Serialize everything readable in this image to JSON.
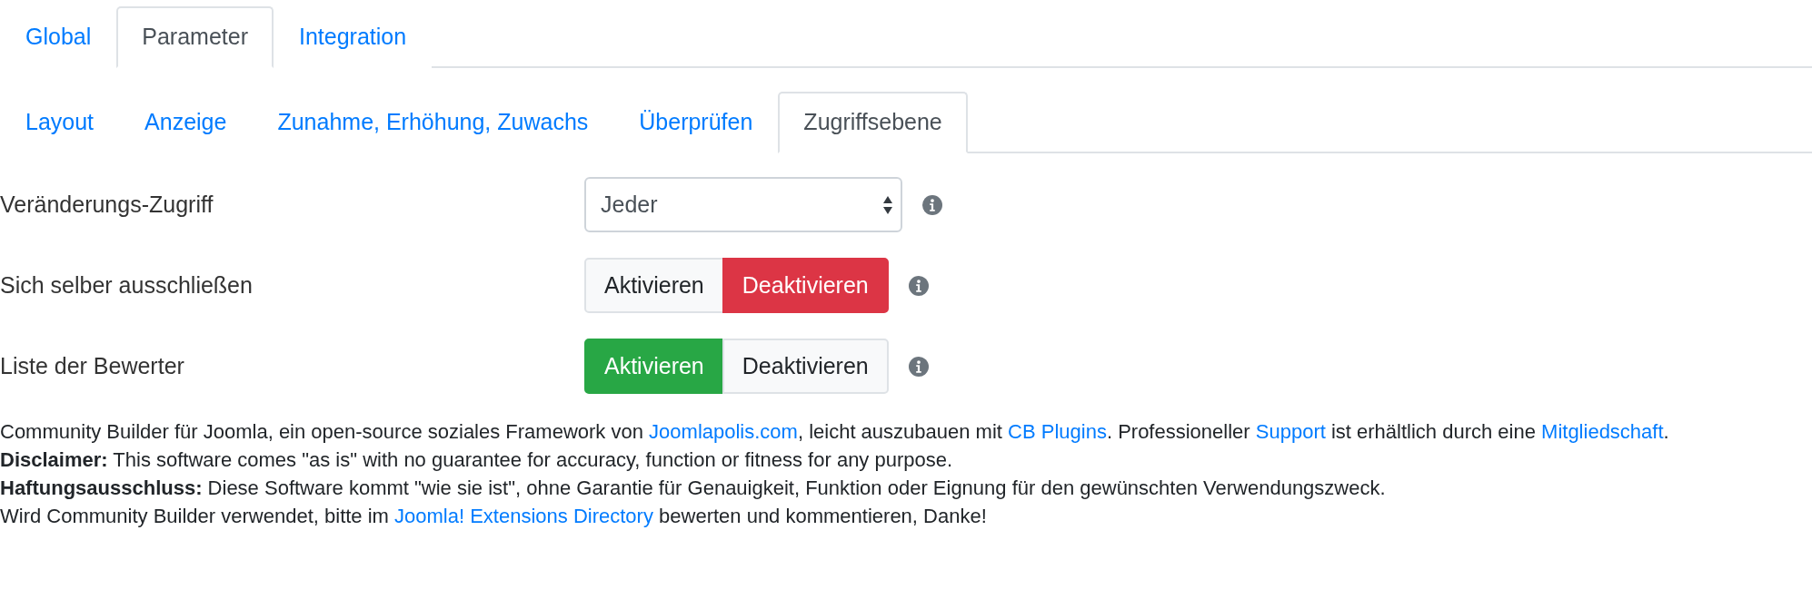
{
  "tabs": [
    {
      "label": "Global",
      "selected": false
    },
    {
      "label": "Parameter",
      "selected": true
    },
    {
      "label": "Integration",
      "selected": false
    }
  ],
  "subtabs": [
    {
      "label": "Layout",
      "selected": false
    },
    {
      "label": "Anzeige",
      "selected": false
    },
    {
      "label": "Zunahme, Erhöhung, Zuwachs",
      "selected": false
    },
    {
      "label": "Überprüfen",
      "selected": false
    },
    {
      "label": "Zugriffsebene",
      "selected": true
    }
  ],
  "fields": [
    {
      "kind": "select",
      "label": "Veränderungs-Zugriff",
      "value": "Jeder"
    },
    {
      "kind": "toggle",
      "label": "Sich selber ausschließen",
      "options": [
        {
          "label": "Aktivieren",
          "selected": false
        },
        {
          "label": "Deaktivieren",
          "selected": true
        }
      ]
    },
    {
      "kind": "toggle",
      "label": "Liste der Bewerter",
      "options": [
        {
          "label": "Aktivieren",
          "selected": true
        },
        {
          "label": "Deaktivieren",
          "selected": false
        }
      ]
    }
  ],
  "footer": [
    [
      {
        "text": "Community Builder für Joomla, ein open-source soziales Framework von "
      },
      {
        "text": "Joomlapolis.com",
        "link": true
      },
      {
        "text": ", leicht auszubauen mit "
      },
      {
        "text": "CB Plugins",
        "link": true
      },
      {
        "text": ". Professioneller "
      },
      {
        "text": "Support",
        "link": true
      },
      {
        "text": " ist erhältlich durch eine "
      },
      {
        "text": "Mitgliedschaft",
        "link": true
      },
      {
        "text": "."
      }
    ],
    [
      {
        "text": "**Disclaimer:** This software comes \"as is\" with no guarantee for accuracy, function or fitness for any purpose."
      }
    ],
    [
      {
        "text": "**Haftungsausschluss:** Diese Software kommt \"wie sie ist\", ohne Garantie für Genauigkeit, Funktion oder Eignung für den gewünschten Verwendungszweck."
      }
    ],
    [
      {
        "text": "Wird Community Builder verwendet, bitte im "
      },
      {
        "text": "Joomla! Extensions Directory",
        "link": true
      },
      {
        "text": " bewerten und kommentieren, Danke!"
      }
    ]
  ]
}
